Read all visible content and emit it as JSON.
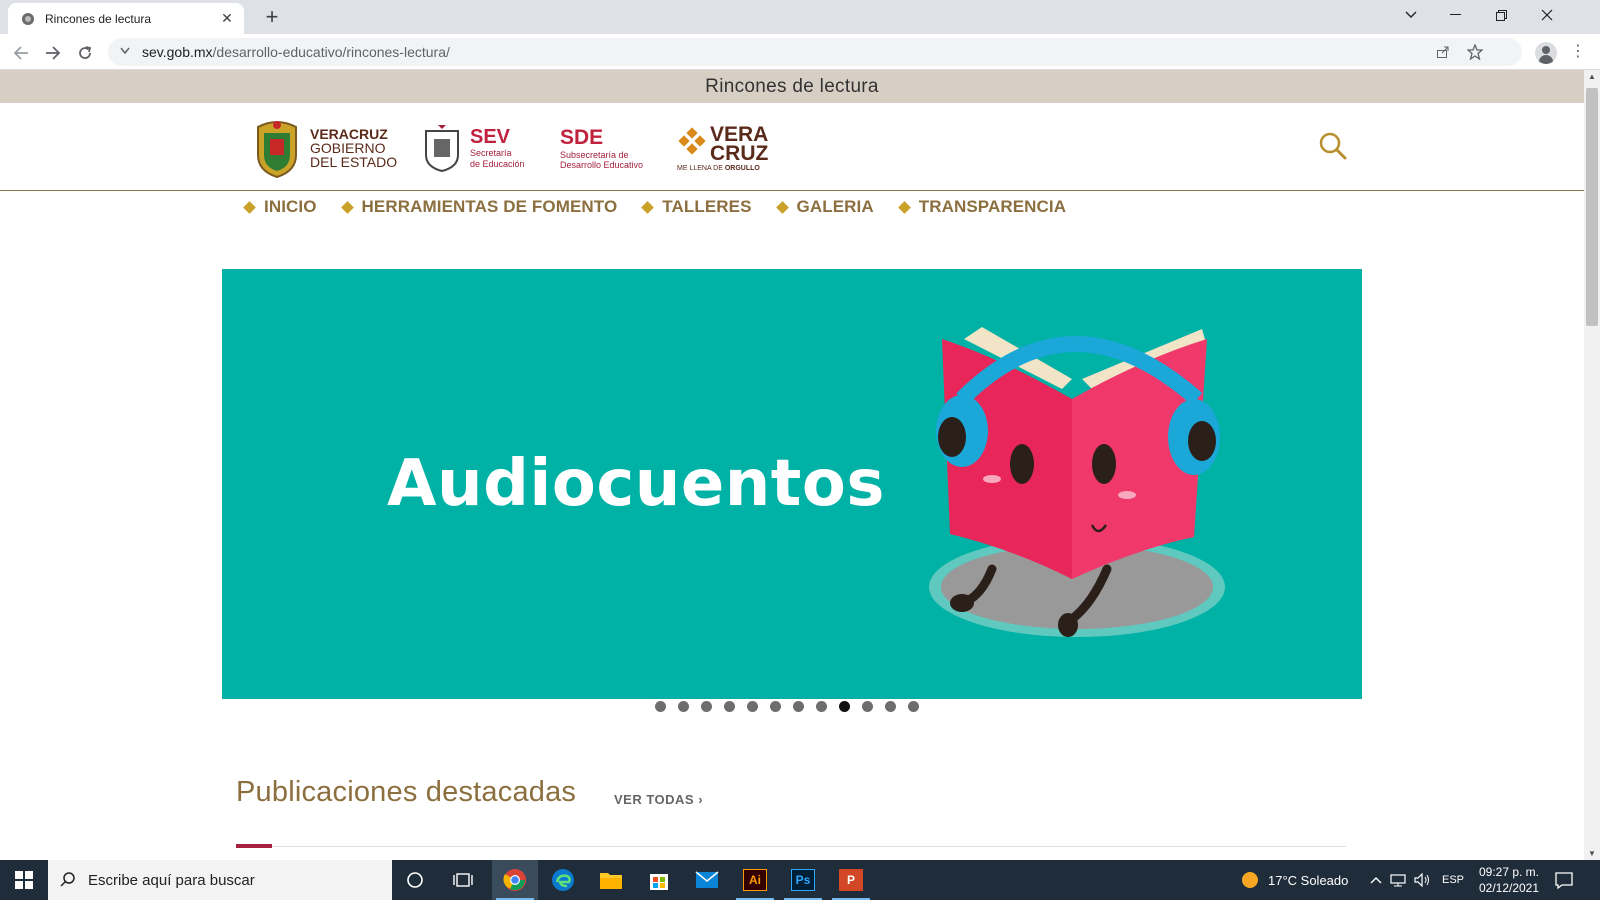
{
  "browser": {
    "tab_title": "Rincones de lectura",
    "tab_close": "✕",
    "new_tab": "+",
    "url_host": "sev.gob.mx",
    "url_path": "/desarrollo-educativo/rincones-lectura/"
  },
  "page": {
    "band_title": "Rincones de lectura",
    "logos": {
      "veracruz": {
        "line1": "VERACRUZ",
        "line2": "GOBIERNO",
        "line3": "DEL ESTADO"
      },
      "sev": {
        "title": "SEV",
        "line1": "Secretaría",
        "line2": "de Educación"
      },
      "sde": {
        "title": "SDE",
        "line1": "Subsecretaría de",
        "line2": "Desarrollo Educativo"
      },
      "veracruz_brand": {
        "line1": "VERA",
        "line2": "CRUZ",
        "tagline_prefix": "ME LLENA DE ",
        "tagline_bold": "ORGULLO"
      }
    },
    "nav": [
      {
        "label": "INICIO"
      },
      {
        "label": "HERRAMIENTAS DE FOMENTO"
      },
      {
        "label": "TALLERES"
      },
      {
        "label": "GALERIA"
      },
      {
        "label": "TRANSPARENCIA"
      }
    ],
    "carousel": {
      "slide_title": "Audiocuentos",
      "background": "#00b1a5",
      "dot_count": 12,
      "active_dot": 9
    },
    "publications": {
      "title": "Publicaciones destacadas",
      "see_all": "VER TODAS ›"
    }
  },
  "taskbar": {
    "search_placeholder": "Escribe aquí para buscar",
    "weather": "17°C  Soleado",
    "language": "ESP",
    "time": "09:27 p. m.",
    "date": "02/12/2021"
  },
  "colors": {
    "accent_gold": "#8c6f3f",
    "diamond": "#c9a227",
    "band": "#d8cfc4",
    "carousel_bg": "#00b1a5",
    "mascot_pink": "#e8265a",
    "headphones": "#1ba8d8",
    "underline": "#a4203c"
  }
}
